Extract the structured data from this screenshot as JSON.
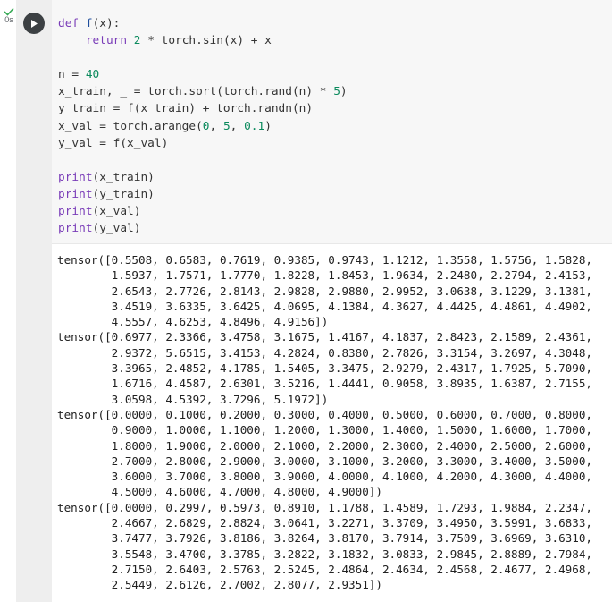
{
  "cell": {
    "status_icon": "check-icon",
    "exec_time": "0s",
    "run_icon": "play-icon",
    "colors": {
      "check": "#34a853",
      "keyword": "#7a3db8",
      "function": "#1f4e9c",
      "number": "#0b8a5d",
      "text": "#333333",
      "code_bg": "#f7f7f7",
      "gutter_bg": "#eeeeee"
    }
  },
  "code": {
    "l1": {
      "kw": "def",
      "fn": "f",
      "rest": "(x):"
    },
    "l2": {
      "kw": "return",
      "num": "2",
      "rest": " * torch.sin(x) + x"
    },
    "l3": "",
    "l4": {
      "pre": "n = ",
      "num": "40"
    },
    "l5": {
      "pre": "x_train, _ = torch.sort(torch.rand(n) * ",
      "num": "5",
      "post": ")"
    },
    "l6": "y_train = f(x_train) + torch.randn(n)",
    "l7": {
      "pre": "x_val = torch.arange(",
      "n1": "0",
      "sep1": ", ",
      "n2": "5",
      "sep2": ", ",
      "n3": "0.1",
      "post": ")"
    },
    "l8": "y_val = f(x_val)",
    "l9": "",
    "l10": {
      "kw": "print",
      "rest": "(x_train)"
    },
    "l11": {
      "kw": "print",
      "rest": "(y_train)"
    },
    "l12": {
      "kw": "print",
      "rest": "(x_val)"
    },
    "l13": {
      "kw": "print",
      "rest": "(y_val)"
    }
  },
  "output": [
    "tensor([0.5508, 0.6583, 0.7619, 0.9385, 0.9743, 1.1212, 1.3558, 1.5756, 1.5828,",
    "        1.5937, 1.7571, 1.7770, 1.8228, 1.8453, 1.9634, 2.2480, 2.2794, 2.4153,",
    "        2.6543, 2.7726, 2.8143, 2.9828, 2.9880, 2.9952, 3.0638, 3.1229, 3.1381,",
    "        3.4519, 3.6335, 3.6425, 4.0695, 4.1384, 4.3627, 4.4425, 4.4861, 4.4902,",
    "        4.5557, 4.6253, 4.8496, 4.9156])",
    "tensor([0.6977, 2.3366, 3.4758, 3.1675, 1.4167, 4.1837, 2.8423, 2.1589, 2.4361,",
    "        2.9372, 5.6515, 3.4153, 4.2824, 0.8380, 2.7826, 3.3154, 3.2697, 4.3048,",
    "        3.3965, 2.4852, 4.1785, 1.5405, 3.3475, 2.9279, 2.4317, 1.7925, 5.7090,",
    "        1.6716, 4.4587, 2.6301, 3.5216, 1.4441, 0.9058, 3.8935, 1.6387, 2.7155,",
    "        3.0598, 4.5392, 3.7296, 5.1972])",
    "tensor([0.0000, 0.1000, 0.2000, 0.3000, 0.4000, 0.5000, 0.6000, 0.7000, 0.8000,",
    "        0.9000, 1.0000, 1.1000, 1.2000, 1.3000, 1.4000, 1.5000, 1.6000, 1.7000,",
    "        1.8000, 1.9000, 2.0000, 2.1000, 2.2000, 2.3000, 2.4000, 2.5000, 2.6000,",
    "        2.7000, 2.8000, 2.9000, 3.0000, 3.1000, 3.2000, 3.3000, 3.4000, 3.5000,",
    "        3.6000, 3.7000, 3.8000, 3.9000, 4.0000, 4.1000, 4.2000, 4.3000, 4.4000,",
    "        4.5000, 4.6000, 4.7000, 4.8000, 4.9000])",
    "tensor([0.0000, 0.2997, 0.5973, 0.8910, 1.1788, 1.4589, 1.7293, 1.9884, 2.2347,",
    "        2.4667, 2.6829, 2.8824, 3.0641, 3.2271, 3.3709, 3.4950, 3.5991, 3.6833,",
    "        3.7477, 3.7926, 3.8186, 3.8264, 3.8170, 3.7914, 3.7509, 3.6969, 3.6310,",
    "        3.5548, 3.4700, 3.3785, 3.2822, 3.1832, 3.0833, 2.9845, 2.8889, 2.7984,",
    "        2.7150, 2.6403, 2.5763, 2.5245, 2.4864, 2.4634, 2.4568, 2.4677, 2.4968,",
    "        2.5449, 2.6126, 2.7002, 2.8077, 2.9351])"
  ]
}
